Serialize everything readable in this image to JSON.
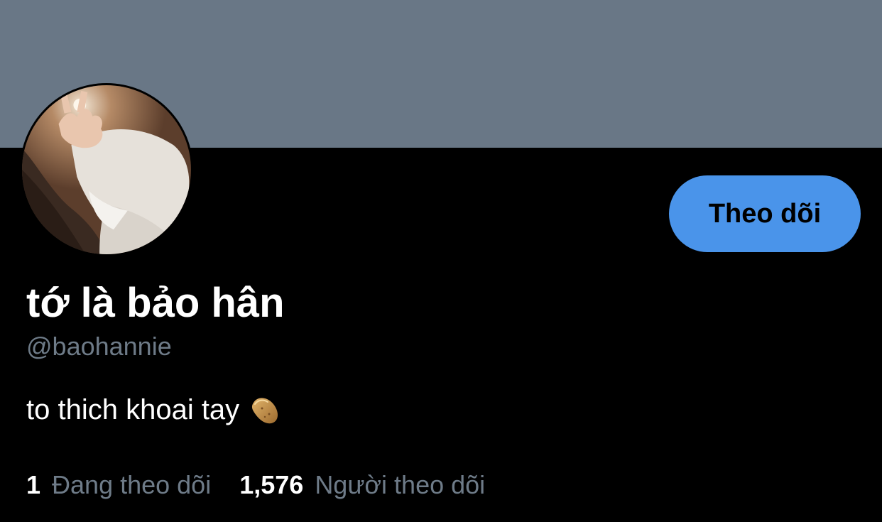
{
  "colors": {
    "banner": "#697786",
    "background": "#000000",
    "accent": "#4a94ea",
    "secondary_text": "#6e7b88",
    "primary_text": "#ffffff"
  },
  "profile": {
    "display_name": "tớ là bảo hân",
    "handle": "@baohannie",
    "bio": "to thich khoai tay",
    "bio_emoji_icon": "potato-icon",
    "avatar_icon": "profile-photo"
  },
  "actions": {
    "follow_label": "Theo dõi"
  },
  "stats": {
    "following_count": "1",
    "following_label": "Đang theo dõi",
    "followers_count": "1,576",
    "followers_label": "Người theo dõi"
  }
}
